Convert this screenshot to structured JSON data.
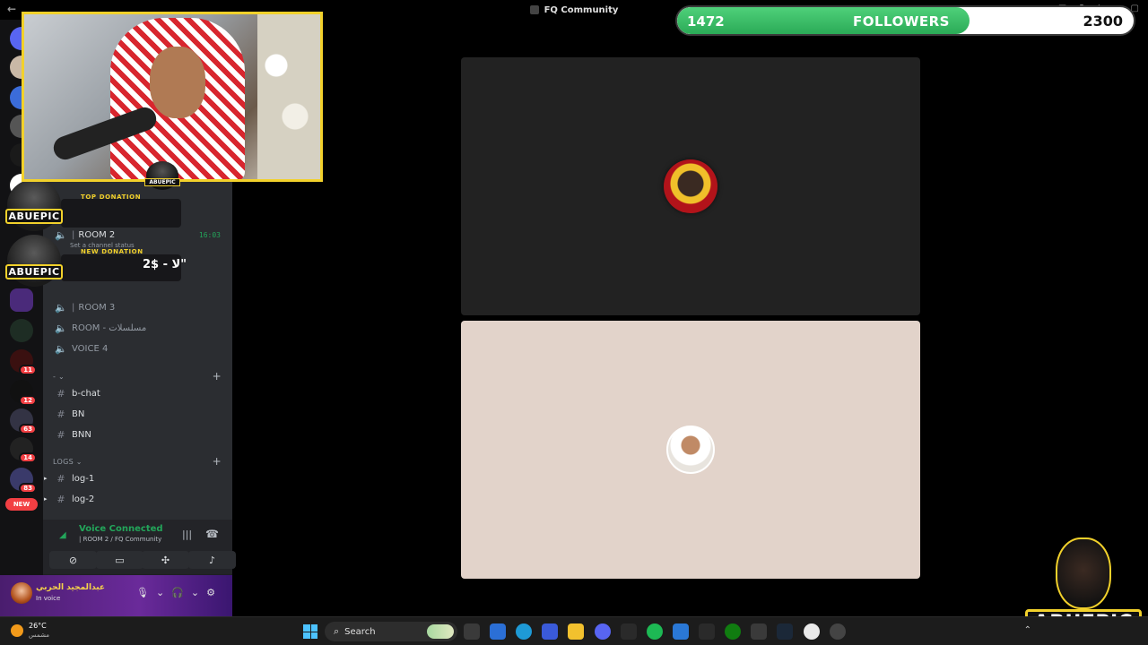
{
  "titlebar": {
    "title": "FQ Community",
    "back_icon": "arrow-left-icon"
  },
  "rail": {
    "badges": [
      "11",
      "12",
      "63",
      "14",
      "83"
    ],
    "new_label": "NEW"
  },
  "sidebar": {
    "channels_top": [
      {
        "name": "ROOM 2",
        "time": "16:03",
        "status": "Set a channel status"
      },
      {
        "name": "ROOM 3"
      },
      {
        "name": "ROOM - مسلسلات"
      },
      {
        "name": "VOICE 4"
      }
    ],
    "cat1": {
      "label": "- ⌄"
    },
    "text_channels": [
      "b-chat",
      "BN",
      "BNN"
    ],
    "cat2": {
      "label": "LOGS ⌄"
    },
    "logs": [
      "log-1",
      "log-2"
    ]
  },
  "voice": {
    "title": "Voice Connected",
    "sub": "| ROOM 2 / FQ Community"
  },
  "user": {
    "name": "عبدالمجيد الحربي",
    "status": "In voice"
  },
  "donations": {
    "logo_text": "ABUEPIC",
    "top_label": "TOP DONATION",
    "new_label": "NEW DONATION",
    "amount": "2$ - ﻻ\""
  },
  "followers": {
    "current": "1472",
    "label": "FOLLOWERS",
    "goal": "2300",
    "progress": 0.64
  },
  "corner_logo": {
    "text": "ABUEPIC"
  },
  "taskbar": {
    "weather_temp": "26°C",
    "weather_cond": "مشمس",
    "search_label": "Search"
  }
}
